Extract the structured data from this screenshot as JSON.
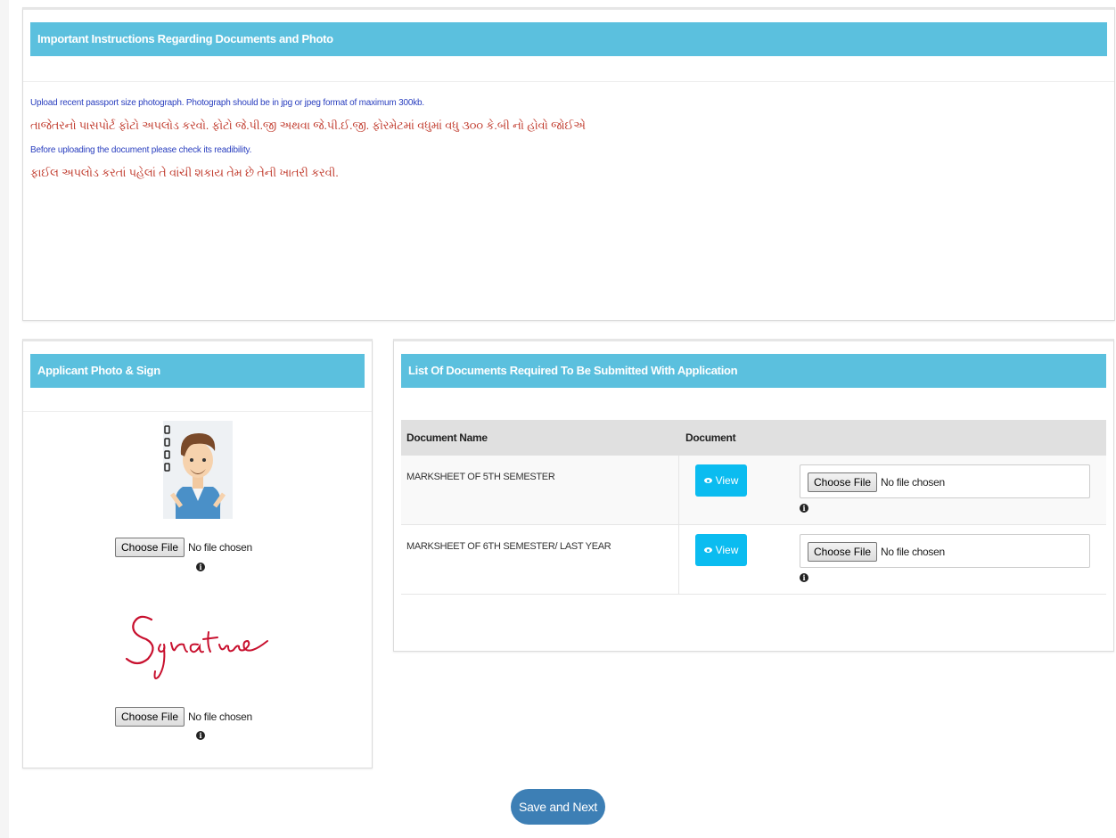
{
  "instructions": {
    "title": "Important Instructions Regarding Documents and Photo",
    "lines": [
      "Upload recent passport size photograph. Photograph should be in jpg or jpeg format of maximum 300kb.",
      "તાજેતરનો પાસપોર્ટ ફોટો અપલોડ કરવો. ફોટો જે.પી.જી અથવા જે.પી.ઈ.જી. ફોરમેટમાં વધુમાં વધુ ૩૦૦ કે.બી નો હોવો જોઈએ",
      "Before uploading the document please check its readibility.",
      "ફાઈલ અપલોડ કરતાં પહેલાં તે વાંચી શકાય તેમ છે તેની ખાતરી કરવી."
    ]
  },
  "photo_sign": {
    "title": "Applicant Photo & Sign",
    "photo_file": {
      "button": "Choose File",
      "status": "No file chosen"
    },
    "signature_text": "Signature",
    "sign_file": {
      "button": "Choose File",
      "status": "No file chosen"
    }
  },
  "documents": {
    "title": "List Of Documents Required To Be Submitted With Application",
    "columns": [
      "Document Name",
      "Document"
    ],
    "rows": [
      {
        "name": "MARKSHEET OF 5TH SEMESTER",
        "view_label": "View",
        "file_button": "Choose File",
        "file_status": "No file chosen"
      },
      {
        "name": "MARKSHEET OF 6TH SEMESTER/ LAST YEAR",
        "view_label": "View",
        "file_button": "Choose File",
        "file_status": "No file chosen"
      }
    ]
  },
  "actions": {
    "save_next": "Save and Next"
  },
  "colors": {
    "panel_header": "#5bc0de",
    "view_button": "#0bbcf0",
    "save_button": "#3d7fb5",
    "gujarati_text": "#c0392b",
    "english_text": "#2a3fbf"
  }
}
